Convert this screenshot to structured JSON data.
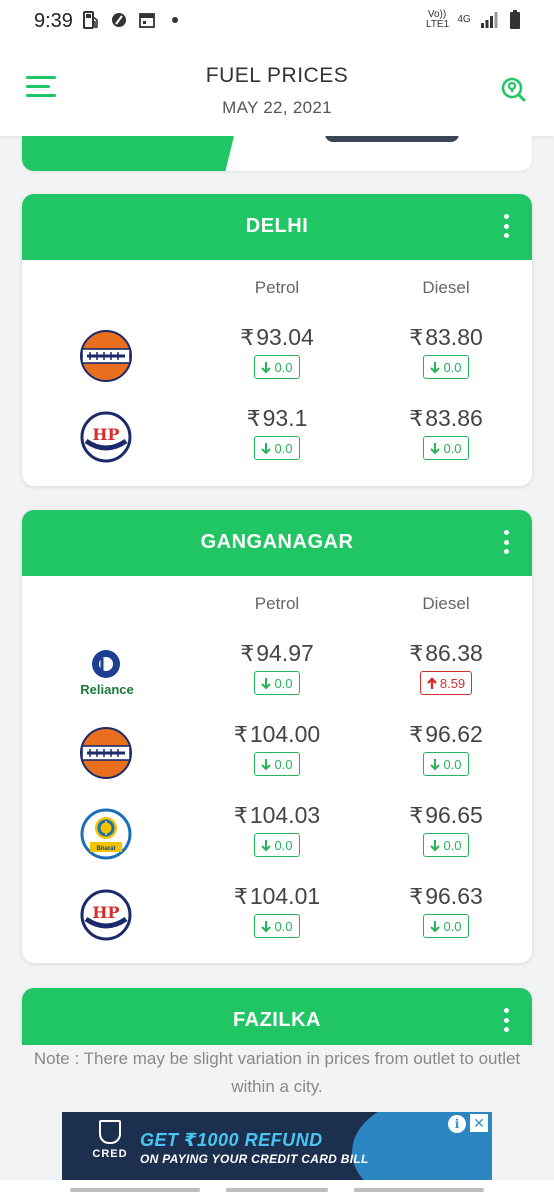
{
  "status_bar": {
    "time": "9:39",
    "volte": "Vo))\nLTE1",
    "network": "4G",
    "icons": [
      "fuel-pump-icon",
      "app-icon",
      "calendar-icon",
      "dot-icon",
      "signal-icon",
      "battery-icon"
    ]
  },
  "header": {
    "title": "FUEL PRICES",
    "date": "MAY 22, 2021",
    "menu_icon": "hamburger-menu-icon",
    "locate_icon": "location-search-icon"
  },
  "colors": {
    "accent": "#20c564",
    "down": "#27b35a",
    "up": "#d32f2f"
  },
  "cities": [
    {
      "name": "DELHI",
      "petrol_label": "Petrol",
      "diesel_label": "Diesel",
      "rows": [
        {
          "brand": "Indian Oil",
          "petrol": "93.04",
          "petrol_change": "0.0",
          "petrol_dir": "down",
          "diesel": "83.80",
          "diesel_change": "0.0",
          "diesel_dir": "down"
        },
        {
          "brand": "HP",
          "petrol": "93.1",
          "petrol_change": "0.0",
          "petrol_dir": "down",
          "diesel": "83.86",
          "diesel_change": "0.0",
          "diesel_dir": "down"
        }
      ]
    },
    {
      "name": "GANGANAGAR",
      "petrol_label": "Petrol",
      "diesel_label": "Diesel",
      "rows": [
        {
          "brand": "Reliance",
          "petrol": "94.97",
          "petrol_change": "0.0",
          "petrol_dir": "down",
          "diesel": "86.38",
          "diesel_change": "8.59",
          "diesel_dir": "up"
        },
        {
          "brand": "Indian Oil",
          "petrol": "104.00",
          "petrol_change": "0.0",
          "petrol_dir": "down",
          "diesel": "96.62",
          "diesel_change": "0.0",
          "diesel_dir": "down"
        },
        {
          "brand": "Bharat Petroleum",
          "petrol": "104.03",
          "petrol_change": "0.0",
          "petrol_dir": "down",
          "diesel": "96.65",
          "diesel_change": "0.0",
          "diesel_dir": "down"
        },
        {
          "brand": "HP",
          "petrol": "104.01",
          "petrol_change": "0.0",
          "petrol_dir": "down",
          "diesel": "96.63",
          "diesel_change": "0.0",
          "diesel_dir": "down"
        }
      ]
    },
    {
      "name": "FAZILKA"
    }
  ],
  "currency_symbol": "₹",
  "note": "Note : There may be slight variation in prices from outlet to outlet within a city.",
  "ad": {
    "brand": "CRED",
    "headline": "GET ₹1000 REFUND",
    "subline": "ON PAYING YOUR CREDIT CARD BILL",
    "info_label": "i",
    "close_label": "✕"
  }
}
